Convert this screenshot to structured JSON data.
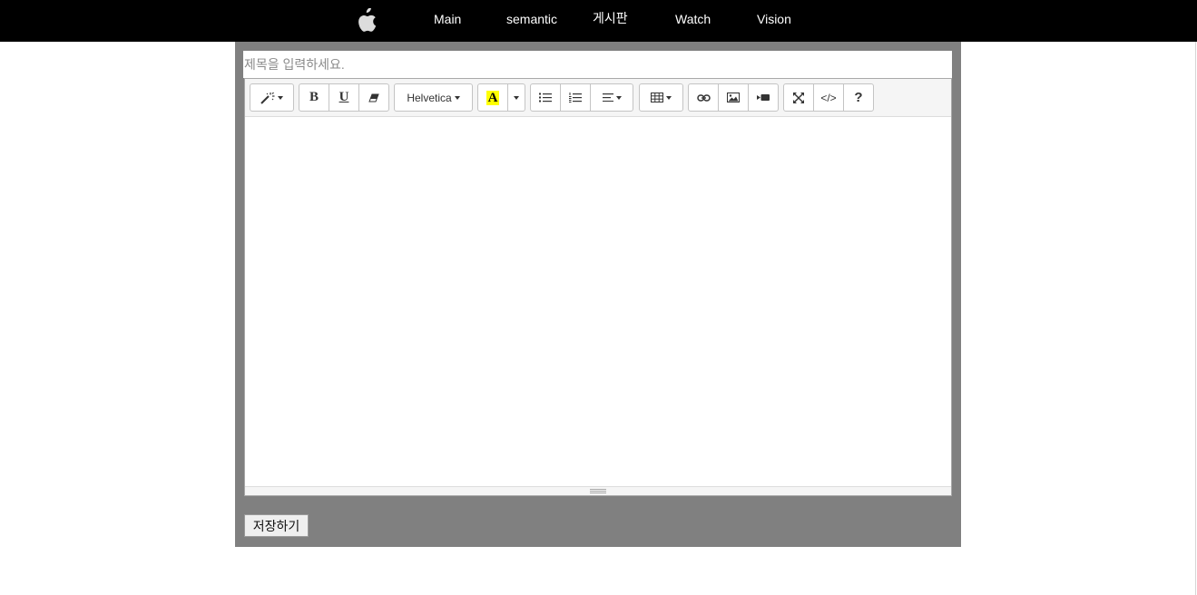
{
  "nav": {
    "logo_icon": "apple-logo-icon",
    "links": [
      "Main",
      "semantic",
      "게시판",
      "Watch",
      "Vision"
    ]
  },
  "title_input": {
    "placeholder": "제목을 입력하세요.",
    "value": ""
  },
  "toolbar": {
    "style_icon": "magic-wand-icon",
    "bold_label": "B",
    "underline_label": "U",
    "clear_icon": "eraser-icon",
    "font_name": "Helvetica",
    "color_label": "A",
    "color_highlight": "#ffff00",
    "unordered_list_icon": "unordered-list-icon",
    "ordered_list_icon": "ordered-list-icon",
    "paragraph_icon": "align-left-icon",
    "table_icon": "table-icon",
    "link_icon": "link-icon",
    "picture_icon": "picture-icon",
    "video_icon": "video-icon",
    "fullscreen_icon": "fullscreen-icon",
    "codeview_label": "</>",
    "help_label": "?"
  },
  "editor": {
    "content": ""
  },
  "save_button": {
    "label": "저장하기"
  },
  "colors": {
    "nav_bg": "#000000",
    "panel_bg": "#808080",
    "toolbar_bg": "#f5f5f5"
  }
}
